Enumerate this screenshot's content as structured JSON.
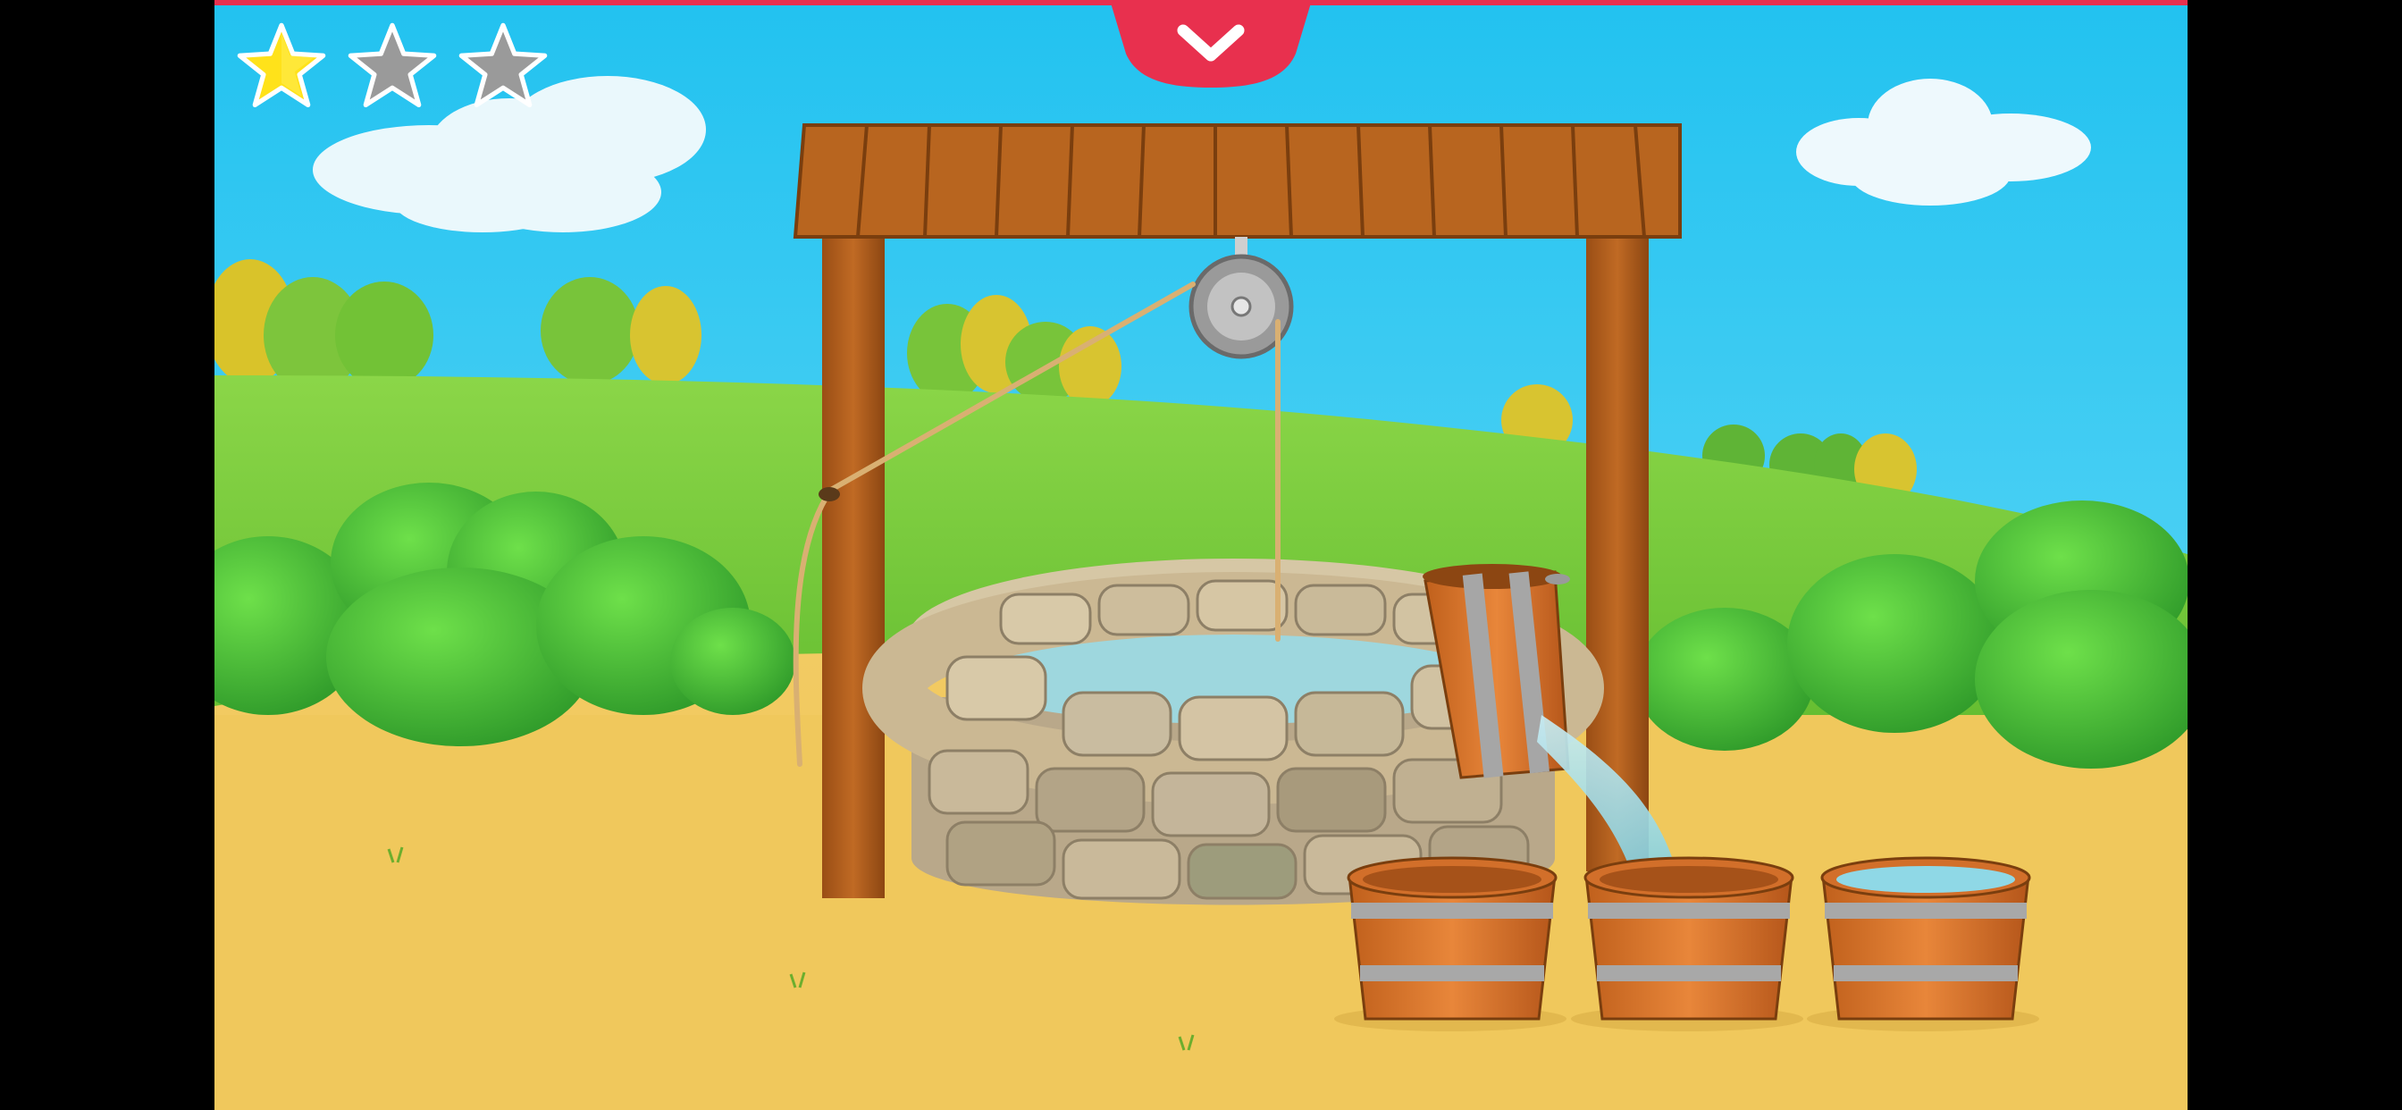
{
  "game": {
    "progress": {
      "stars_total": 3,
      "stars_earned": 1
    },
    "menu_toggle": {
      "icon": "chevron-down-icon"
    },
    "scene": {
      "well": {
        "has_roof": true,
        "has_pulley": true,
        "rope": true
      },
      "buckets": [
        {
          "id": 1,
          "state": "empty"
        },
        {
          "id": 2,
          "state": "filling"
        },
        {
          "id": 3,
          "state": "full"
        }
      ],
      "hanging_bucket": {
        "state": "pouring"
      }
    },
    "colors": {
      "accent": "#e8304e",
      "star_filled": "#ffe21a",
      "star_empty": "#9a9a9a",
      "sky": "#27c9f2",
      "grass": "#7ccf3a",
      "ground": "#f0c659",
      "wood": "#b8651f",
      "water": "#8fd8e6"
    }
  }
}
